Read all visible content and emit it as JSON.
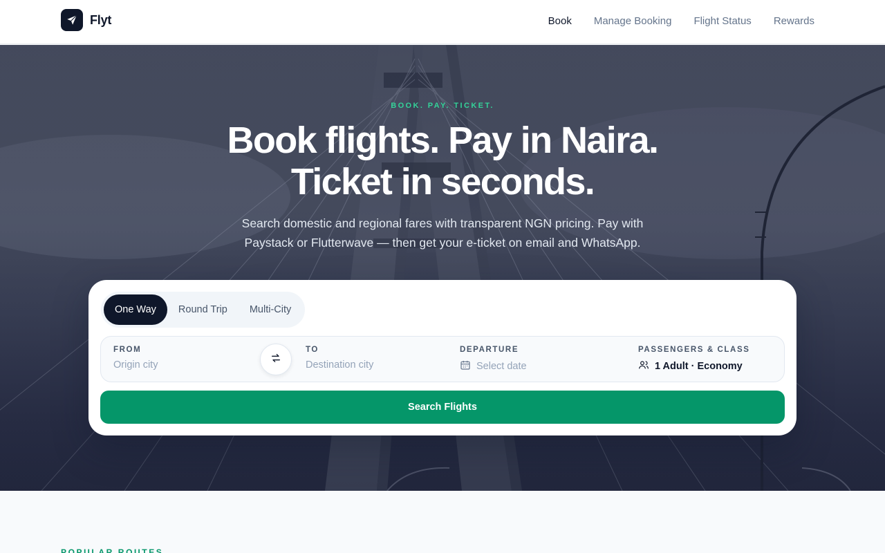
{
  "brand": {
    "name": "Flyt"
  },
  "nav": {
    "items": [
      "Book",
      "Manage Booking",
      "Flight Status",
      "Rewards"
    ],
    "active": "Book"
  },
  "hero": {
    "eyebrow": "BOOK. PAY. TICKET.",
    "title_line1": "Book flights. Pay in Naira.",
    "title_line2": "Ticket in seconds.",
    "subtitle": "Search domestic and regional fares with transparent NGN pricing. Pay with Paystack or Flutterwave — then get your e-ticket on email and WhatsApp."
  },
  "search": {
    "trip_types": [
      "One Way",
      "Round Trip",
      "Multi-City"
    ],
    "selected_trip_type": "One Way",
    "from": {
      "label": "FROM",
      "placeholder": "Origin city"
    },
    "to": {
      "label": "TO",
      "placeholder": "Destination city"
    },
    "departure": {
      "label": "DEPARTURE",
      "placeholder": "Select date"
    },
    "passengers": {
      "label": "PASSENGERS & CLASS",
      "value": "1 Adult · Economy"
    },
    "submit_label": "Search Flights"
  },
  "popular": {
    "eyebrow": "POPULAR ROUTES"
  },
  "colors": {
    "primary": "#059669",
    "dark": "#0f172a",
    "accent": "#34d399",
    "muted": "#64748b"
  },
  "icons": {
    "logo": "paper-plane-icon",
    "swap": "swap-arrows-icon",
    "date": "calendar-icon",
    "passengers": "users-icon"
  }
}
